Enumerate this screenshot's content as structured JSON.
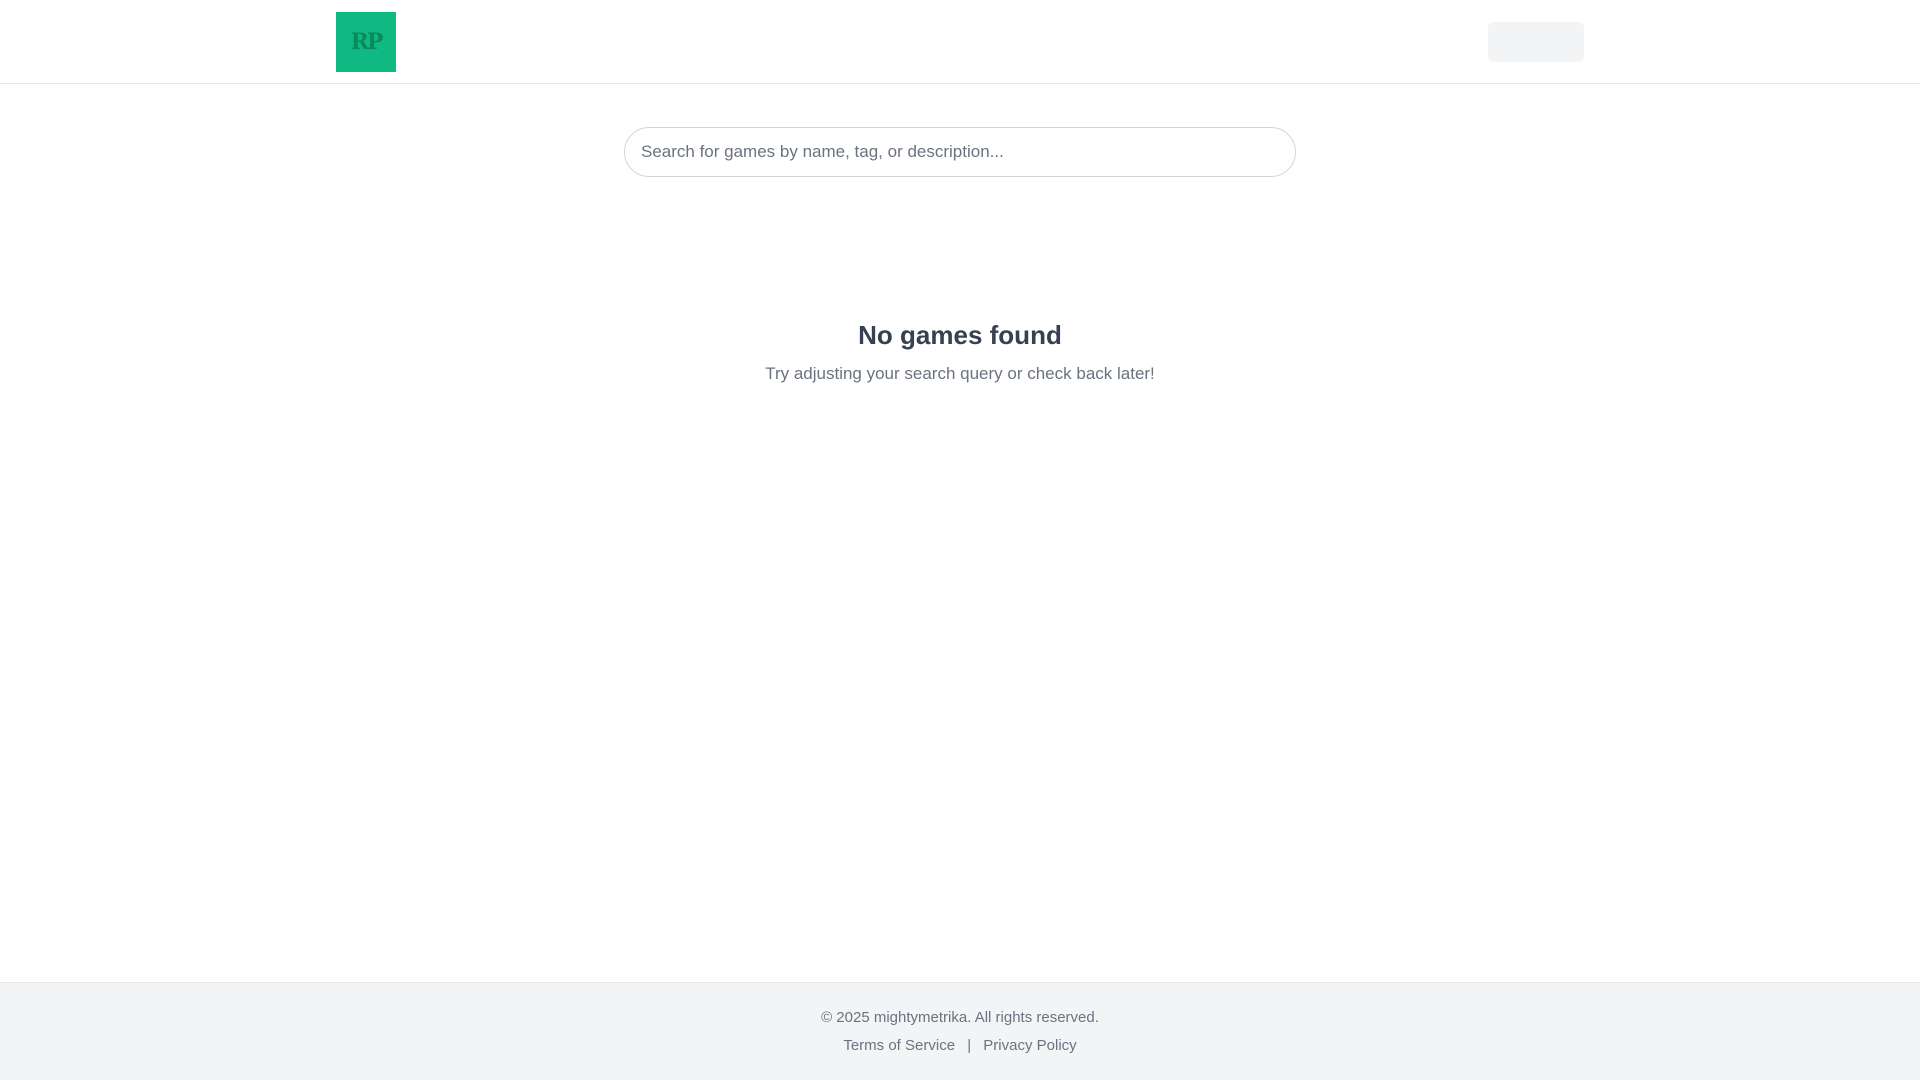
{
  "header": {
    "logo_text": "RP"
  },
  "search": {
    "placeholder": "Search for games by name, tag, or description...",
    "value": ""
  },
  "empty_state": {
    "title": "No games found",
    "subtitle": "Try adjusting your search query or check back later!"
  },
  "footer": {
    "copyright": "© 2025 mightymetrika. All rights reserved.",
    "links": [
      {
        "label": "Terms of Service"
      },
      {
        "label": "Privacy Policy"
      }
    ],
    "separator": "|"
  },
  "colors": {
    "brand": "#10b981",
    "text_primary": "#374151",
    "text_muted": "#6b7280",
    "footer_bg": "#f3f4f6",
    "border": "#e5e7eb"
  }
}
